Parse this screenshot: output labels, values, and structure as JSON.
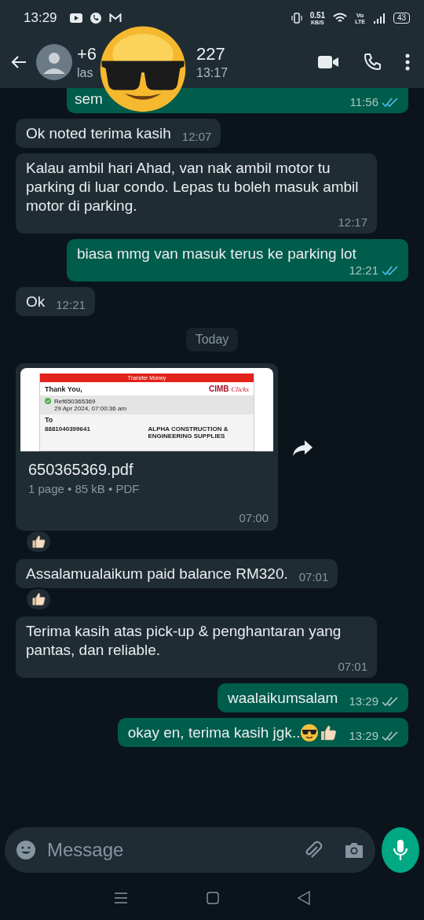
{
  "status_bar": {
    "time": "13:29",
    "speed": "0.51",
    "speed_unit": "KB/S",
    "network_top": "Vo",
    "network_bottom": "LTE",
    "battery": "43"
  },
  "header": {
    "name_start": "+6",
    "name_end": "227",
    "status_start": "las",
    "status_end": "13:17"
  },
  "messages": [
    {
      "kind": "text",
      "outgoing": true,
      "cut": true,
      "text": "sem",
      "time": "11:56",
      "read": true
    },
    {
      "kind": "text",
      "outgoing": false,
      "text": "Ok noted terima kasih",
      "time": "12:07"
    },
    {
      "kind": "text",
      "outgoing": false,
      "text": "Kalau ambil hari Ahad, van nak ambil motor tu parking di luar condo. Lepas tu boleh masuk ambil motor di parking.",
      "time": "12:17"
    },
    {
      "kind": "text",
      "outgoing": true,
      "text": "biasa mmg van masuk terus ke parking lot",
      "time": "12:21",
      "read": true
    },
    {
      "kind": "text",
      "outgoing": false,
      "text": "Ok",
      "time": "12:21"
    },
    {
      "kind": "date",
      "text": "Today"
    },
    {
      "kind": "document",
      "outgoing": false,
      "file": "650365369.pdf",
      "meta": "1 page • 85 kB • PDF",
      "time": "07:00",
      "reaction": {
        "kind": "thumbs_up"
      },
      "preview": {
        "banner": "Transfer Money",
        "thanks": "Thank You,",
        "brand": "CIMB",
        "brand_script": "Clicks",
        "ref": "Ref650365369",
        "date": "29 Apr 2024, 07:00:36 am",
        "to": "To",
        "account": "8881040399641",
        "recipient": "ALPHA CONSTRUCTION & ENGINEERING SUPPLIES"
      }
    },
    {
      "kind": "text",
      "outgoing": false,
      "text": "Assalamualaikum paid balance RM320.",
      "time": "07:01",
      "reaction": {
        "kind": "thumbs_up"
      }
    },
    {
      "kind": "text",
      "outgoing": false,
      "text": "Terima kasih atas pick-up & penghantaran yang pantas, dan reliable.",
      "time": "07:01"
    },
    {
      "kind": "text",
      "outgoing": true,
      "text": "waalaikumsalam",
      "time": "13:29",
      "read": false
    },
    {
      "kind": "text",
      "outgoing": true,
      "text": "okay en, terima kasih jgk..",
      "emoji": [
        {
          "kind": "sunglasses"
        },
        {
          "kind": "thumbs_up"
        }
      ],
      "time": "13:29",
      "read": false
    }
  ],
  "composer": {
    "placeholder": "Message"
  }
}
